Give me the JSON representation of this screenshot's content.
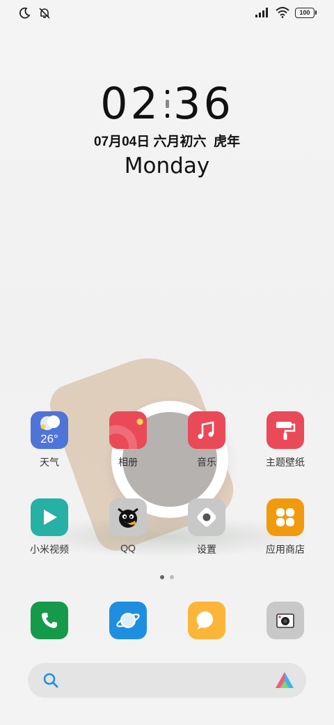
{
  "status_bar": {
    "battery": "100",
    "icons": [
      "moon-icon",
      "mute-vibrate-icon",
      "signal-icon",
      "wifi-icon",
      "battery-icon"
    ]
  },
  "lockscreen": {
    "time_hours": "02",
    "time_minutes": "36",
    "date": "07月04日 六月初六  虎年",
    "weekday": "Monday"
  },
  "apps": [
    {
      "label": "天气",
      "icon": "weather-icon",
      "color": "#4f74d8",
      "temp": "26°"
    },
    {
      "label": "相册",
      "icon": "gallery-icon",
      "color": "#ea4a58"
    },
    {
      "label": "音乐",
      "icon": "music-icon",
      "color": "#ea4a58"
    },
    {
      "label": "主题壁纸",
      "icon": "theme-brush-icon",
      "color": "#ea4a58"
    },
    {
      "label": "小米视频",
      "icon": "video-play-icon",
      "color": "#27b0a4"
    },
    {
      "label": "QQ",
      "icon": "qq-penguin-icon",
      "color": "#c8c8c8"
    },
    {
      "label": "设置",
      "icon": "settings-icon",
      "color": "#c8c8c8"
    },
    {
      "label": "应用商店",
      "icon": "app-store-icon",
      "color": "#f29a0d"
    }
  ],
  "dock": [
    {
      "icon": "phone-icon",
      "color": "#159a49"
    },
    {
      "icon": "browser-icon",
      "color": "#1e8fe0"
    },
    {
      "icon": "messages-icon",
      "color": "#fbb63a"
    },
    {
      "icon": "camera-icon",
      "color": "#c8c8c8"
    }
  ],
  "pager": {
    "pages": 2,
    "current": 1
  },
  "search": {
    "icons": [
      "search-icon",
      "assistant-logo-icon"
    ]
  }
}
